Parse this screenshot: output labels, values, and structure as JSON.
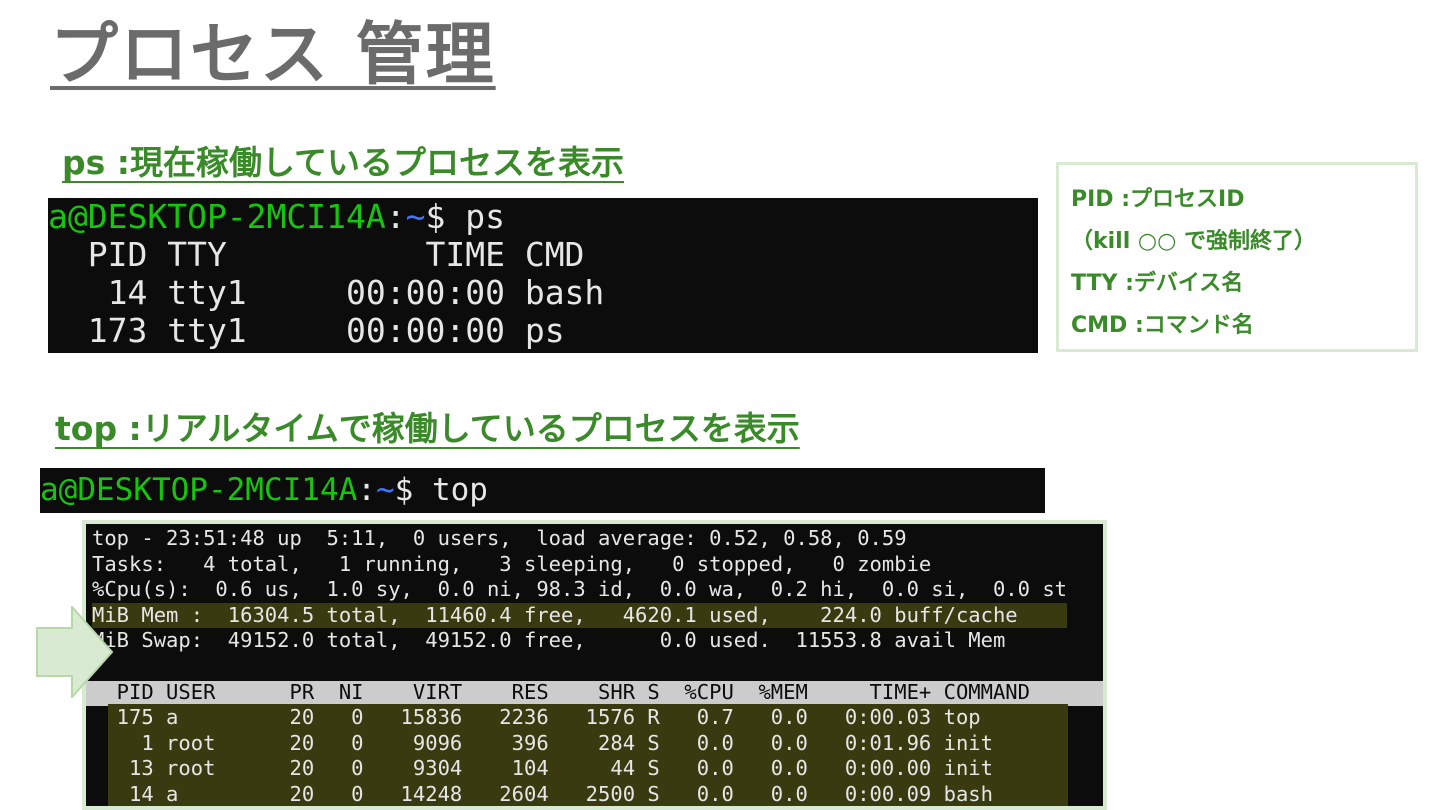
{
  "page": {
    "title": "プロセス 管理",
    "ps_heading": "ps :現在稼働しているプロセスを表示",
    "top_heading": "top :リアルタイムで稼働しているプロセスを表示"
  },
  "ps_terminal": {
    "prompt_user": "a@DESKTOP-2MCI14A",
    "prompt_sep": ":",
    "prompt_path": "~",
    "prompt_cmd": "$ ps",
    "lines": [
      "  PID TTY          TIME CMD",
      "   14 tty1     00:00:00 bash",
      "  173 tty1     00:00:00 ps"
    ]
  },
  "info_box": {
    "lines": [
      "PID :プロセスID",
      "（kill ○○ で強制終了）",
      "TTY :デバイス名",
      "CMD :コマンド名"
    ]
  },
  "top_terminal": {
    "prompt_user": "a@DESKTOP-2MCI14A",
    "prompt_sep": ":",
    "prompt_path": "~",
    "prompt_cmd": "$ top",
    "summary": [
      "top - 23:51:48 up  5:11,  0 users,  load average: 0.52, 0.58, 0.59",
      "Tasks:   4 total,   1 running,   3 sleeping,   0 stopped,   0 zombie",
      "%Cpu(s):  0.6 us,  1.0 sy,  0.0 ni, 98.3 id,  0.0 wa,  0.2 hi,  0.0 si,  0.0 st",
      "MiB Mem :  16304.5 total,  11460.4 free,   4620.1 used,    224.0 buff/cache",
      "MiB Swap:  49152.0 total,  49152.0 free,      0.0 used.  11553.8 avail Mem",
      ""
    ],
    "header": "  PID USER      PR  NI    VIRT    RES    SHR S  %CPU  %MEM     TIME+ COMMAND",
    "rows": [
      "  175 a         20   0   15836   2236   1576 R   0.7   0.0   0:00.03 top",
      "    1 root      20   0    9096    396    284 S   0.0   0.0   0:01.96 init",
      "   13 root      20   0    9304    104     44 S   0.0   0.0   0:00.00 init",
      "   14 a         20   0   14248   2604   2500 S   0.0   0.0   0:00.09 bash"
    ]
  },
  "colors": {
    "heading_green": "#3a8a2a",
    "title_gray": "#6b6b6b",
    "terminal_bg": "#0c0c0c",
    "prompt_green": "#16c60c",
    "prompt_blue": "#3b78ff",
    "box_border": "#d9ead3"
  }
}
